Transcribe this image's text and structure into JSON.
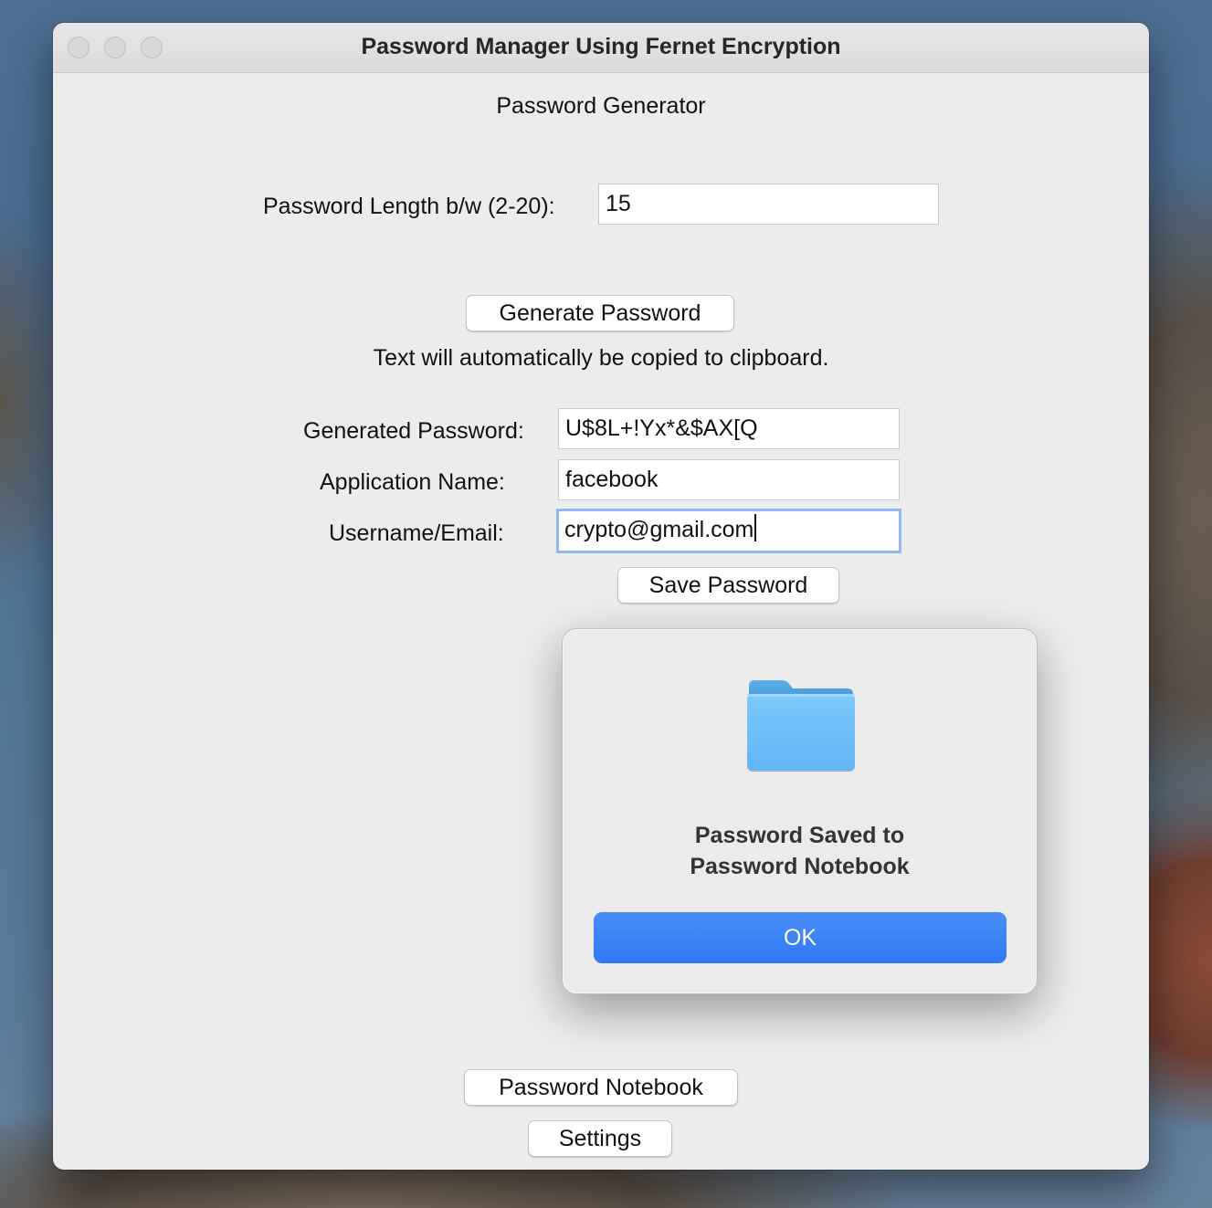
{
  "window": {
    "title": "Password Manager Using Fernet Encryption"
  },
  "generator": {
    "heading": "Password Generator",
    "length_label": "Password Length b/w (2-20):",
    "length_value": "15",
    "generate_button": "Generate Password",
    "clipboard_note": "Text will automatically be copied to clipboard."
  },
  "form": {
    "generated_password_label": "Generated Password:",
    "generated_password_value": "U$8L+!Yx*&$AX[Q",
    "application_name_label": "Application Name:",
    "application_name_value": "facebook",
    "username_label": "Username/Email:",
    "username_value": "crypto@gmail.com",
    "save_button": "Save Password"
  },
  "dialog": {
    "icon": "folder-icon",
    "message_line1": "Password Saved to",
    "message_line2": "Password Notebook",
    "ok_button": "OK",
    "accent_color": "#3a82f6"
  },
  "footer": {
    "notebook_button": "Password Notebook",
    "settings_button": "Settings"
  }
}
